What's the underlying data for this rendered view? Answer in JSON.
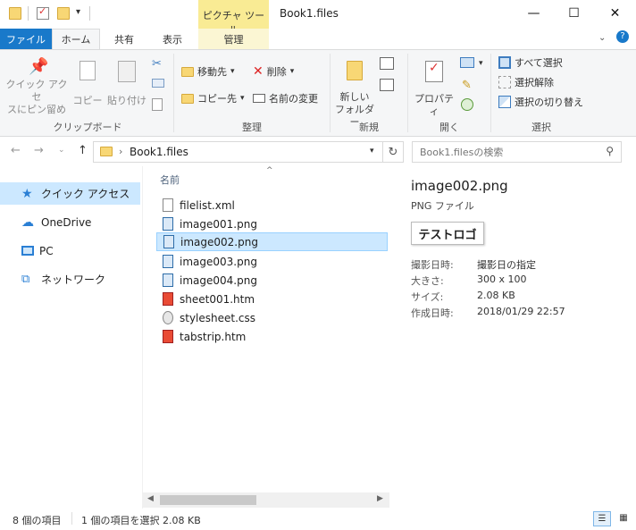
{
  "window": {
    "title": "Book1.files",
    "context_tab_title": "ピクチャ ツール"
  },
  "tabs": [
    {
      "label": "ファイル"
    },
    {
      "label": "ホーム"
    },
    {
      "label": "共有"
    },
    {
      "label": "表示"
    },
    {
      "label": "管理"
    }
  ],
  "ribbon": {
    "clipboard": {
      "label": "クリップボード",
      "pin_line1": "クイック アクセ",
      "pin_line2": "スにピン留め",
      "copy": "コピー",
      "paste": "貼り付け"
    },
    "organize": {
      "label": "整理",
      "move_to": "移動先",
      "copy_to": "コピー先",
      "delete": "削除",
      "rename": "名前の変更"
    },
    "new": {
      "label": "新規",
      "new_folder_line1": "新しい",
      "new_folder_line2": "フォルダー"
    },
    "open": {
      "label": "開く",
      "properties": "プロパティ"
    },
    "select": {
      "label": "選択",
      "select_all": "すべて選択",
      "select_none": "選択解除",
      "invert": "選択の切り替え"
    }
  },
  "address": {
    "path": "Book1.files",
    "search_placeholder": "Book1.filesの検索"
  },
  "nav": [
    {
      "label": "クイック アクセス",
      "icon": "star-icon"
    },
    {
      "label": "OneDrive",
      "icon": "cloud-icon"
    },
    {
      "label": "PC",
      "icon": "monitor-icon"
    },
    {
      "label": "ネットワーク",
      "icon": "network-icon"
    }
  ],
  "file_list": {
    "column_header": "名前",
    "files": [
      {
        "name": "filelist.xml",
        "type": "xml"
      },
      {
        "name": "image001.png",
        "type": "png"
      },
      {
        "name": "image002.png",
        "type": "png",
        "selected": true
      },
      {
        "name": "image003.png",
        "type": "png"
      },
      {
        "name": "image004.png",
        "type": "png"
      },
      {
        "name": "sheet001.htm",
        "type": "htm"
      },
      {
        "name": "stylesheet.css",
        "type": "css"
      },
      {
        "name": "tabstrip.htm",
        "type": "htm"
      }
    ]
  },
  "preview": {
    "filename": "image002.png",
    "filetype": "PNG ファイル",
    "image_text": "テストロゴ",
    "props": [
      {
        "label": "撮影日時:",
        "value": "撮影日の指定"
      },
      {
        "label": "大きさ:",
        "value": "300 x 100"
      },
      {
        "label": "サイズ:",
        "value": "2.08 KB"
      },
      {
        "label": "作成日時:",
        "value": "2018/01/29 22:57"
      }
    ]
  },
  "status": {
    "item_count": "8 個の項目",
    "selected": "1 個の項目を選択  2.08 KB"
  },
  "colors": {
    "accent": "#1979ca",
    "selection": "#cce8ff",
    "context_tab": "#f9eb94"
  }
}
